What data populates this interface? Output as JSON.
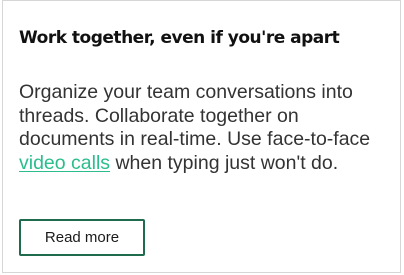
{
  "card": {
    "title": "Work together, even if you're apart",
    "body_before_link": "Organize your team conversations into threads. Collaborate together on documents in real-time. Use face-to-face ",
    "link_text": "video calls",
    "body_after_link": " when typing just won't do.",
    "button_label": "Read more"
  },
  "colors": {
    "link": "#2bbd8e",
    "button_border": "#1f6b4e",
    "card_border": "#d6d6d6"
  }
}
